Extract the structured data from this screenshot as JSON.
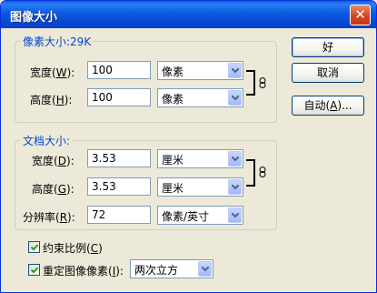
{
  "window": {
    "title": "图像大小",
    "close_glyph": "✕"
  },
  "pixel_dims": {
    "legend": "像素大小:29K",
    "width": {
      "label": "宽度(",
      "key": "W",
      "suffix": "):",
      "value": "100",
      "unit": "像素"
    },
    "height": {
      "label": "高度(",
      "key": "H",
      "suffix": "):",
      "value": "100",
      "unit": "像素"
    }
  },
  "doc_size": {
    "legend": "文档大小:",
    "width": {
      "label": "宽度(",
      "key": "D",
      "suffix": "):",
      "value": "3.53",
      "unit": "厘米"
    },
    "height": {
      "label": "高度(",
      "key": "G",
      "suffix": "):",
      "value": "3.53",
      "unit": "厘米"
    },
    "resolution": {
      "label": "分辨率(",
      "key": "R",
      "suffix": "):",
      "value": "72",
      "unit": "像素/英寸"
    }
  },
  "options": {
    "constrain": {
      "label": "约束比例(",
      "key": "C",
      "suffix": ")",
      "checked": true
    },
    "resample": {
      "label": "重定图像像素(",
      "key": "I",
      "suffix": "):",
      "checked": true,
      "method": "两次立方"
    }
  },
  "buttons": {
    "ok": "好",
    "cancel": "取消",
    "auto": {
      "label": "自动(",
      "key": "A",
      "suffix": ")..."
    }
  },
  "icons": {
    "link": "chain-link-icon",
    "dropdown": "chevron-down-icon",
    "check": "checkmark-icon"
  }
}
